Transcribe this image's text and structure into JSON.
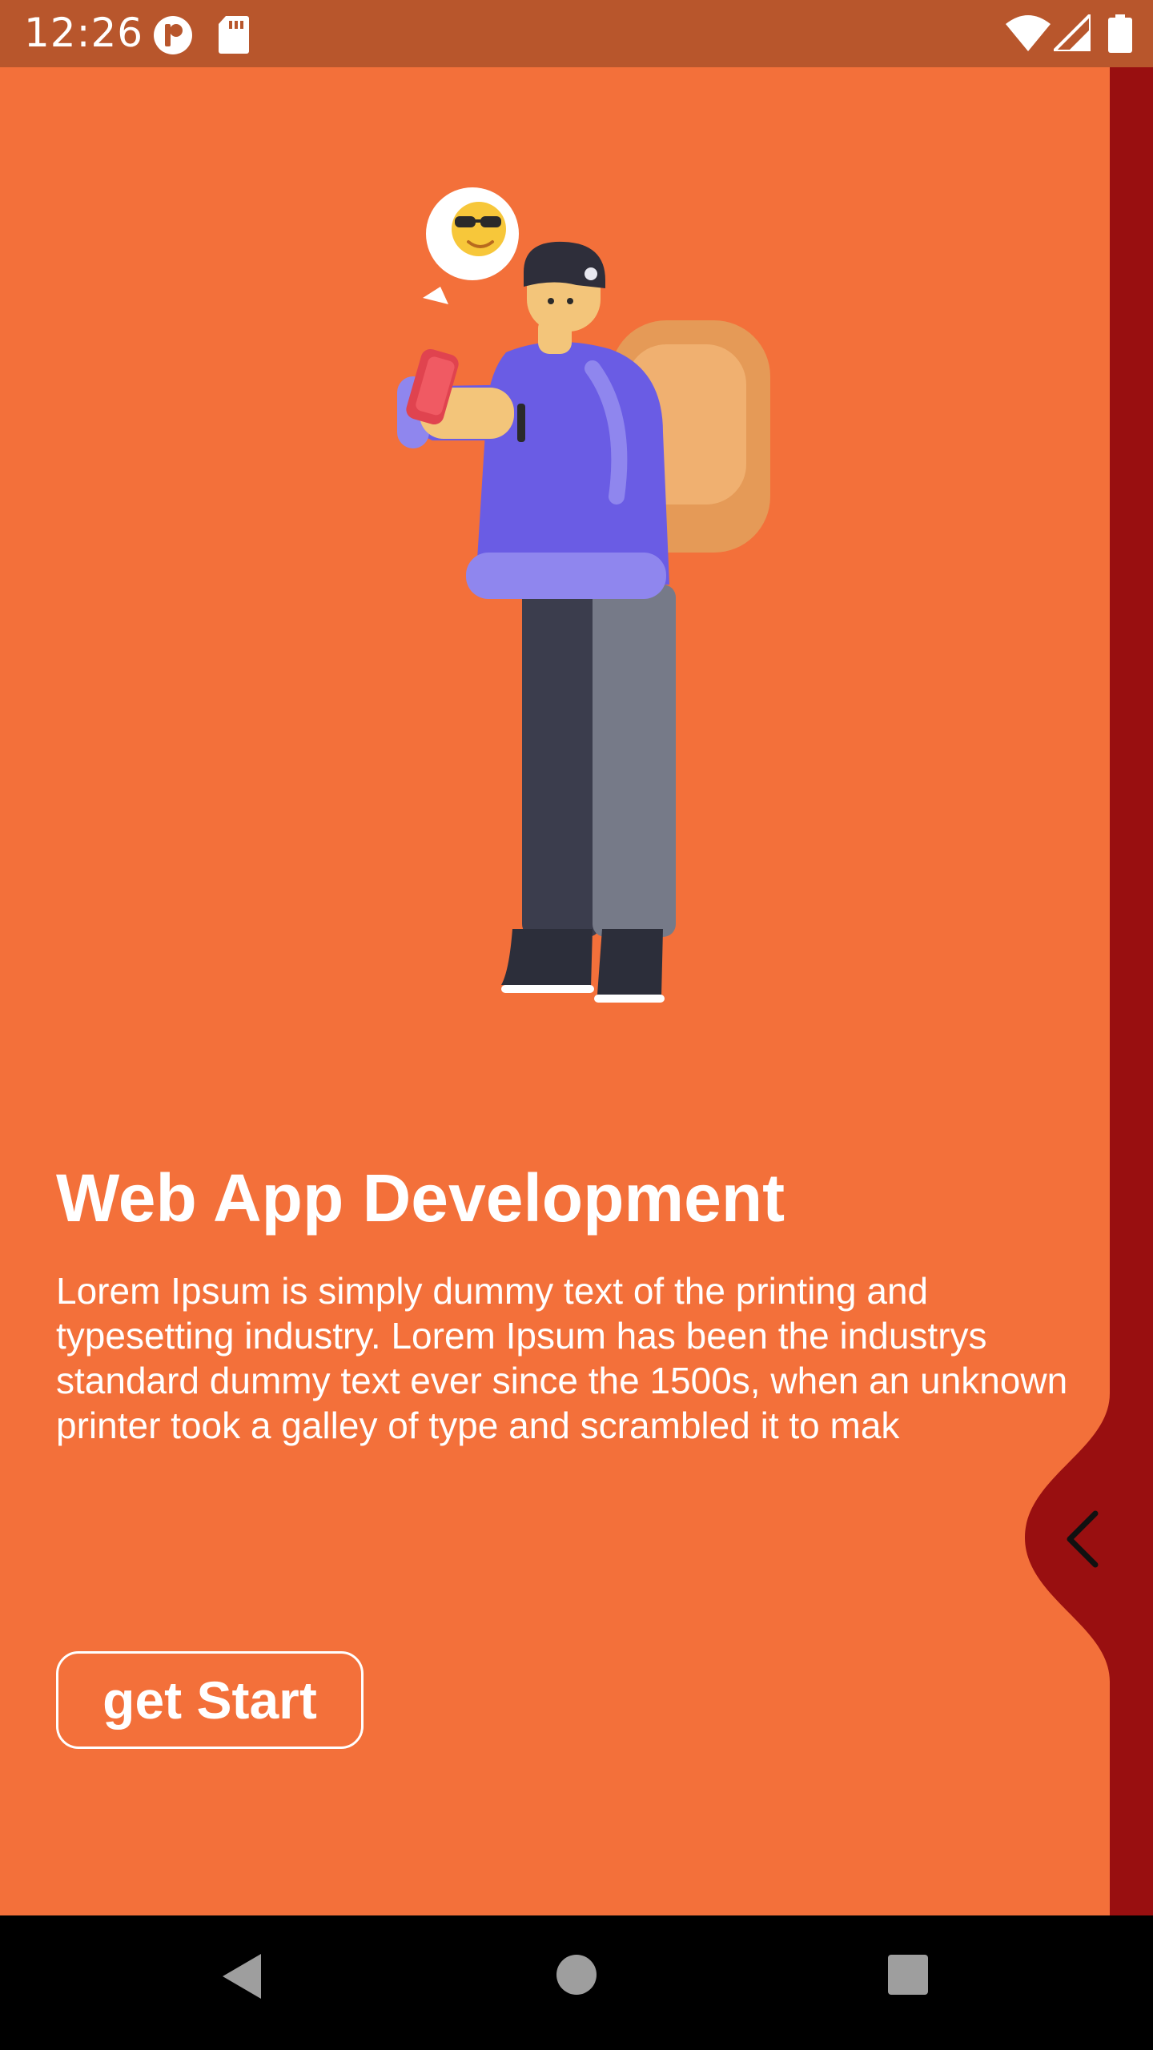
{
  "status_bar": {
    "time": "12:26",
    "icons": [
      "app-notification-icon",
      "sd-card-icon",
      "wifi-icon",
      "signal-icon",
      "battery-icon"
    ]
  },
  "onboarding": {
    "title": "Web App Development",
    "description": "Lorem Ipsum is simply dummy text of the printing and typesetting industry. Lorem Ipsum has been the industrys standard dummy text ever since the 1500s, when an unknown printer took a galley of type and scrambled it to mak",
    "button_label": "get Start",
    "illustration": "person-with-backpack-using-phone",
    "back_icon": "chevron-left-icon"
  },
  "colors": {
    "background": "#F3703A",
    "status_bar": "#B8562C",
    "next_page": "#990F10",
    "text": "#FFFFFF"
  },
  "nav_bar": {
    "icons": [
      "back-triangle-icon",
      "home-circle-icon",
      "recents-square-icon"
    ]
  }
}
